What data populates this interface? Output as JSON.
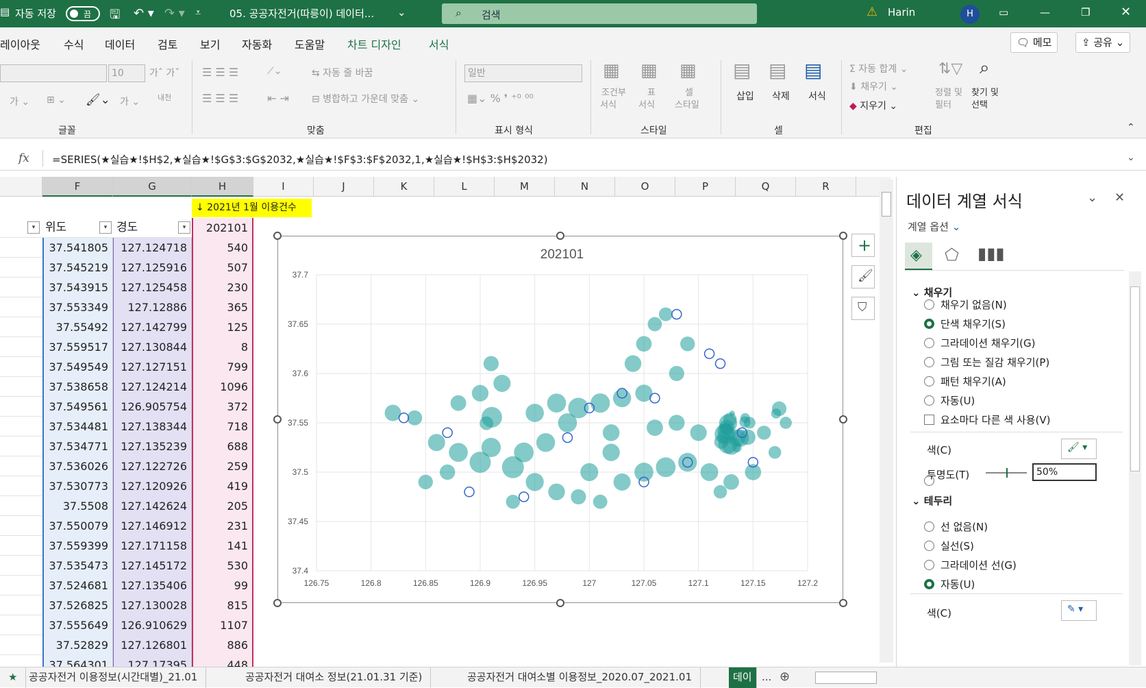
{
  "title_bar": {
    "autosave_label": "자동 저장",
    "autosave_state": "끔",
    "file_name": "05. 공공자전거(따릉이) 데이터...",
    "search_placeholder": "검색",
    "user_name": "Harin",
    "user_initial": "H"
  },
  "menu": {
    "items": [
      "레이아웃",
      "수식",
      "데이터",
      "검토",
      "보기",
      "자동화",
      "도움말",
      "차트 디자인",
      "서식"
    ],
    "memo_label": "메모",
    "share_label": "공유"
  },
  "ribbon": {
    "font": {
      "size": "10",
      "group": "글꼴"
    },
    "align": {
      "wrap": "자동 줄 바꿈",
      "merge": "병합하고 가운데 맞춤",
      "group": "맞춤"
    },
    "number": {
      "format": "일반",
      "group": "표시 형식"
    },
    "style": {
      "cond_format": "조건부",
      "cond_format2": "서식",
      "table": "표",
      "table2": "서식",
      "cell": "셀",
      "cell2": "스타일",
      "group": "스타일"
    },
    "cells": {
      "insert": "삽입",
      "delete": "삭제",
      "format": "서식",
      "group": "셀"
    },
    "edit": {
      "autosum": "자동 합계",
      "fill": "채우기",
      "clear": "지우기",
      "sort": "정렬 및",
      "sort2": "필터",
      "find": "찾기 및",
      "find2": "선택",
      "group": "편집"
    }
  },
  "formula": {
    "fx": "fx",
    "text": "=SERIES(★실습★!$H$2,★실습★!$G$3:$G$2032,★실습★!$F$3:$F$2032,1,★실습★!$H$3:$H$2032)"
  },
  "columns": [
    "F",
    "G",
    "H",
    "I",
    "J",
    "K",
    "L",
    "M",
    "N",
    "O",
    "P",
    "Q",
    "R"
  ],
  "sheet": {
    "note": "↓ 2021년 1월 이용건수",
    "headers": {
      "lat": "위도",
      "lon": "경도",
      "count": "202101"
    },
    "rows": [
      [
        "37.541805",
        "127.124718",
        "540"
      ],
      [
        "37.545219",
        "127.125916",
        "507"
      ],
      [
        "37.543915",
        "127.125458",
        "230"
      ],
      [
        "37.553349",
        "127.12886",
        "365"
      ],
      [
        "37.55492",
        "127.142799",
        "125"
      ],
      [
        "37.559517",
        "127.130844",
        "8"
      ],
      [
        "37.549549",
        "127.127151",
        "799"
      ],
      [
        "37.538658",
        "127.124214",
        "1096"
      ],
      [
        "37.549561",
        "126.905754",
        "372"
      ],
      [
        "37.534481",
        "127.138344",
        "718"
      ],
      [
        "37.534771",
        "127.135239",
        "688"
      ],
      [
        "37.536026",
        "127.122726",
        "259"
      ],
      [
        "37.530773",
        "127.120926",
        "419"
      ],
      [
        "37.5508",
        "127.142624",
        "205"
      ],
      [
        "37.550079",
        "127.146912",
        "231"
      ],
      [
        "37.559399",
        "127.171158",
        "141"
      ],
      [
        "37.535473",
        "127.145172",
        "530"
      ],
      [
        "37.524681",
        "127.135406",
        "99"
      ],
      [
        "37.526825",
        "127.130028",
        "815"
      ],
      [
        "37.555649",
        "126.910629",
        "1107"
      ],
      [
        "37.52829",
        "127.126801",
        "886"
      ],
      [
        "37.564301",
        "127.17395",
        "448"
      ]
    ]
  },
  "chart_data": {
    "type": "scatter",
    "title": "202101",
    "xlim": [
      126.75,
      127.2
    ],
    "ylim": [
      37.4,
      37.7
    ],
    "x_ticks": [
      "126.75",
      "126.8",
      "126.85",
      "126.9",
      "126.95",
      "127",
      "127.05",
      "127.1",
      "127.15",
      "127.2"
    ],
    "y_ticks": [
      "37.7",
      "37.65",
      "37.6",
      "37.55",
      "37.5",
      "37.45",
      "37.4"
    ],
    "marker_color": "#1f9e9a",
    "series": [
      {
        "name": "202101",
        "points": [
          [
            127.124718,
            37.541805,
            540
          ],
          [
            127.125916,
            37.545219,
            507
          ],
          [
            127.125458,
            37.543915,
            230
          ],
          [
            127.12886,
            37.553349,
            365
          ],
          [
            127.142799,
            37.55492,
            125
          ],
          [
            127.130844,
            37.559517,
            8
          ],
          [
            127.127151,
            37.549549,
            799
          ],
          [
            127.124214,
            37.538658,
            1096
          ],
          [
            126.905754,
            37.549561,
            372
          ],
          [
            127.138344,
            37.534481,
            718
          ],
          [
            127.135239,
            37.534771,
            688
          ],
          [
            127.122726,
            37.536026,
            259
          ],
          [
            127.120926,
            37.530773,
            419
          ],
          [
            127.142624,
            37.5508,
            205
          ],
          [
            127.146912,
            37.550079,
            231
          ],
          [
            127.171158,
            37.559399,
            141
          ],
          [
            127.145172,
            37.535473,
            530
          ],
          [
            127.135406,
            37.524681,
            99
          ],
          [
            127.130028,
            37.526825,
            815
          ],
          [
            126.910629,
            37.555649,
            1107
          ],
          [
            127.126801,
            37.52829,
            886
          ],
          [
            127.17395,
            37.564301,
            448
          ],
          [
            126.82,
            37.56,
            620
          ],
          [
            126.84,
            37.555,
            480
          ],
          [
            126.86,
            37.53,
            700
          ],
          [
            126.88,
            37.52,
            900
          ],
          [
            126.9,
            37.51,
            1200
          ],
          [
            126.91,
            37.525,
            950
          ],
          [
            126.93,
            37.505,
            1300
          ],
          [
            126.95,
            37.49,
            800
          ],
          [
            126.97,
            37.48,
            650
          ],
          [
            126.99,
            37.475,
            500
          ],
          [
            127.01,
            37.47,
            420
          ],
          [
            127.03,
            37.49,
            700
          ],
          [
            127.05,
            37.5,
            900
          ],
          [
            127.07,
            37.505,
            1000
          ],
          [
            127.09,
            37.51,
            880
          ],
          [
            127.11,
            37.5,
            760
          ],
          [
            127.13,
            37.49,
            540
          ],
          [
            127.15,
            37.5,
            600
          ],
          [
            127.16,
            37.54,
            400
          ],
          [
            126.95,
            37.56,
            820
          ],
          [
            126.97,
            37.57,
            900
          ],
          [
            126.99,
            37.565,
            1100
          ],
          [
            127.01,
            37.57,
            950
          ],
          [
            127.03,
            37.575,
            800
          ],
          [
            127.05,
            37.58,
            700
          ],
          [
            127.04,
            37.61,
            650
          ],
          [
            127.05,
            37.63,
            540
          ],
          [
            127.06,
            37.65,
            420
          ],
          [
            127.07,
            37.66,
            380
          ],
          [
            127.08,
            37.6,
            500
          ],
          [
            127.09,
            37.63,
            460
          ],
          [
            126.92,
            37.59,
            700
          ],
          [
            126.91,
            37.61,
            500
          ],
          [
            126.9,
            37.58,
            640
          ],
          [
            126.88,
            37.57,
            550
          ],
          [
            126.94,
            37.52,
            1000
          ],
          [
            126.96,
            37.53,
            880
          ],
          [
            127.02,
            37.52,
            720
          ],
          [
            127.06,
            37.545,
            610
          ],
          [
            127.08,
            37.55,
            580
          ],
          [
            127.1,
            37.54,
            640
          ],
          [
            126.87,
            37.5,
            520
          ],
          [
            126.85,
            37.49,
            450
          ],
          [
            127.0,
            37.5,
            780
          ],
          [
            126.98,
            37.55,
            900
          ],
          [
            127.02,
            37.54,
            660
          ],
          [
            126.93,
            37.47,
            400
          ],
          [
            127.12,
            37.48,
            350
          ],
          [
            127.17,
            37.52,
            300
          ],
          [
            127.18,
            37.55,
            260
          ]
        ]
      }
    ]
  },
  "pane": {
    "title": "데이터 계열 서식",
    "options_label": "계열 옵션",
    "fill_section": "채우기",
    "fill_options": [
      "채우기 없음(N)",
      "단색 채우기(S)",
      "그라데이션 채우기(G)",
      "그림 또는 질감 채우기(P)",
      "패턴 채우기(A)",
      "자동(U)"
    ],
    "vary_colors": "요소마다 다른 색 사용(V)",
    "color_label": "색(C)",
    "transparency_label": "투명도(T)",
    "transparency_value": "50%",
    "transparency_fraction": 0.5,
    "border_section": "테두리",
    "border_options": [
      "선 없음(N)",
      "실선(S)",
      "그라데이션 선(G)",
      "자동(U)"
    ],
    "border_color_label": "색(C)"
  },
  "tabs": [
    "★",
    "공공자전거 이용정보(시간대별)_21.01",
    "공공자전거 대여소 정보(21.01.31 기준)",
    "공공자전거 대여소별 이용정보_2020.07_2021.01",
    "데이",
    "..."
  ],
  "colors": {
    "excel_green": "#1e7145",
    "marker": "#1f9e9a"
  }
}
